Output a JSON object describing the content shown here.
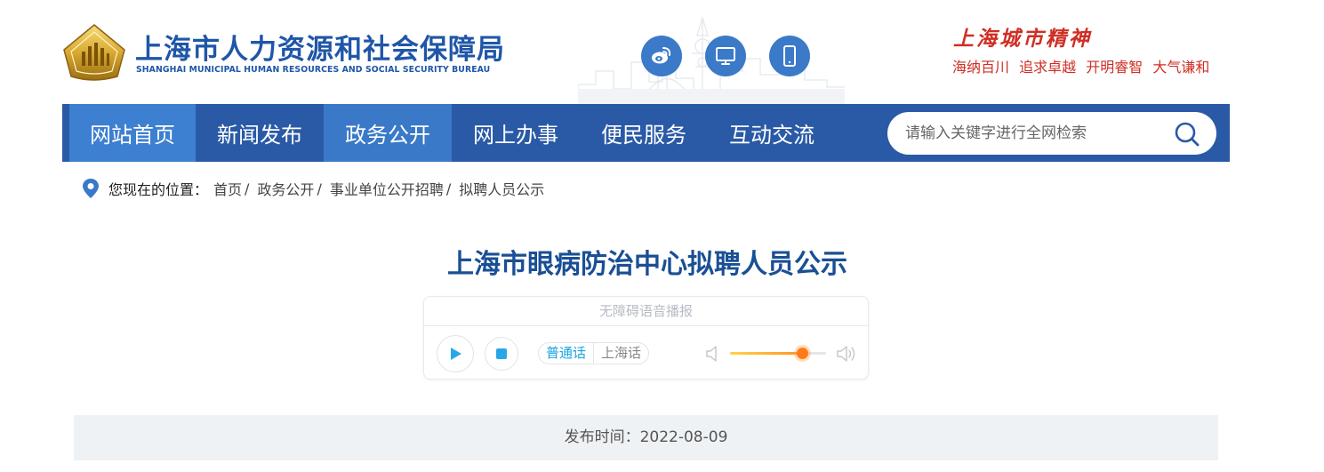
{
  "header": {
    "site_title": "上海市人力资源和社会保障局",
    "site_subtitle": "SHANGHAI MUNICIPAL HUMAN RESOURCES AND SOCIAL SECURITY BUREAU",
    "social_icons": [
      "weibo-icon",
      "desktop-icon",
      "mobile-icon"
    ],
    "spirit_title": "上海城市精神",
    "spirit_motto": [
      "海纳百川",
      "追求卓越",
      "开明睿智",
      "大气谦和"
    ]
  },
  "nav": {
    "items": [
      {
        "label": "网站首页"
      },
      {
        "label": "新闻发布"
      },
      {
        "label": "政务公开"
      },
      {
        "label": "网上办事"
      },
      {
        "label": "便民服务"
      },
      {
        "label": "互动交流"
      }
    ],
    "search_placeholder": "请输入关键字进行全网检索"
  },
  "breadcrumb": {
    "label": "您现在的位置：",
    "items": [
      "首页",
      "政务公开",
      "事业单位公开招聘",
      "拟聘人员公示"
    ]
  },
  "article": {
    "title": "上海市眼病防治中心拟聘人员公示",
    "publish_time": "发布时间：2022-08-09"
  },
  "player": {
    "header": "无障碍语音播报",
    "languages": [
      "普通话",
      "上海话"
    ],
    "selected_language": "普通话",
    "volume": 0.75
  },
  "colors": {
    "brand_blue": "#2a5aa6",
    "nav_active": "#3a79c8",
    "title_blue": "#1a4f95",
    "spirit_red": "#cf2e24",
    "accent_cyan": "#1aa3e0"
  }
}
